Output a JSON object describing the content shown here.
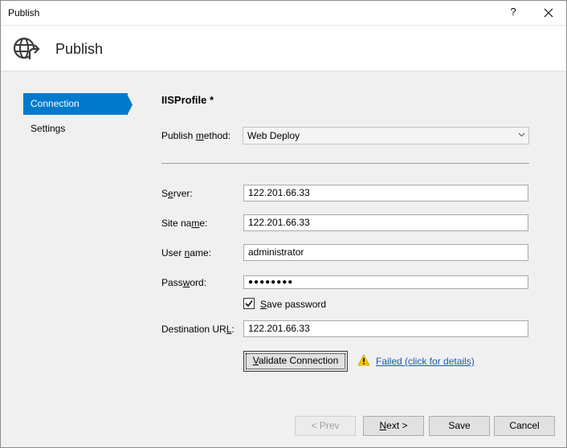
{
  "window": {
    "title": "Publish",
    "help_glyph": "?"
  },
  "banner": {
    "title": "Publish",
    "icon": "globe-publish-icon"
  },
  "nav": {
    "items": [
      {
        "label": "Connection",
        "active": true
      },
      {
        "label": "Settings",
        "active": false
      }
    ]
  },
  "profile": {
    "title": "IISProfile *"
  },
  "form": {
    "publish_method": {
      "label_pre": "Publish ",
      "label_key": "m",
      "label_post": "ethod:",
      "value": "Web Deploy"
    },
    "server": {
      "label_pre": "S",
      "label_key": "e",
      "label_post": "rver:",
      "value": "122.201.66.33"
    },
    "site_name": {
      "label_pre": "Site na",
      "label_key": "m",
      "label_post": "e:",
      "value": "122.201.66.33"
    },
    "user_name": {
      "label_pre": "User ",
      "label_key": "n",
      "label_post": "ame:",
      "value": "administrator"
    },
    "password": {
      "label_pre": "Pass",
      "label_key": "w",
      "label_post": "ord:",
      "value": "●●●●●●●●"
    },
    "save_password": {
      "label_pre": "",
      "label_key": "S",
      "label_post": "ave password",
      "checked": true
    },
    "destination_url": {
      "label_pre": "Destination UR",
      "label_key": "L",
      "label_post": ":",
      "value": "122.201.66.33"
    }
  },
  "validate": {
    "button_key": "V",
    "button_rest": "alidate Connection",
    "status_link": "Failed (click for details)",
    "status_icon": "warning-icon"
  },
  "footer": {
    "prev": "< Prev",
    "next_pre": "",
    "next_key": "N",
    "next_post": "ext >",
    "save": "Save",
    "cancel": "Cancel"
  },
  "colors": {
    "accent": "#007acc",
    "link": "#1a58b5",
    "warning": "#f2c500"
  }
}
